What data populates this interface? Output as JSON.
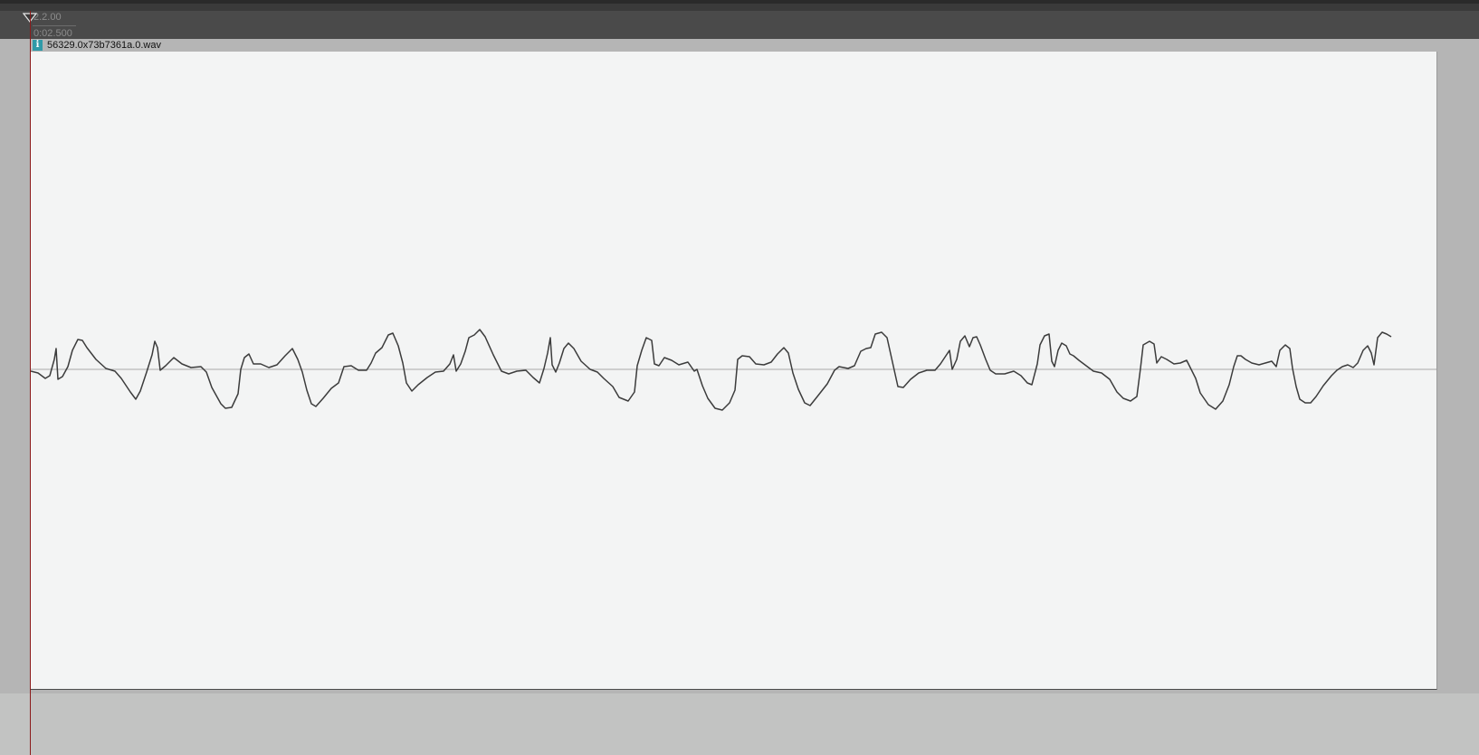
{
  "ruler": {
    "beat": "2.2.00",
    "time": "0:02.500"
  },
  "item": {
    "name": "56329.0x73b7361a.0.wav",
    "info_icon": "info-icon",
    "info_glyph": "i"
  },
  "colors": {
    "ruler_bg": "#4a4a4a",
    "track_bg": "#b5b5b5",
    "item_bg": "#f3f4f4",
    "waveform": "#3c3c3c",
    "playhead": "#8b1a1a",
    "info_badge": "#2f9aa8"
  }
}
